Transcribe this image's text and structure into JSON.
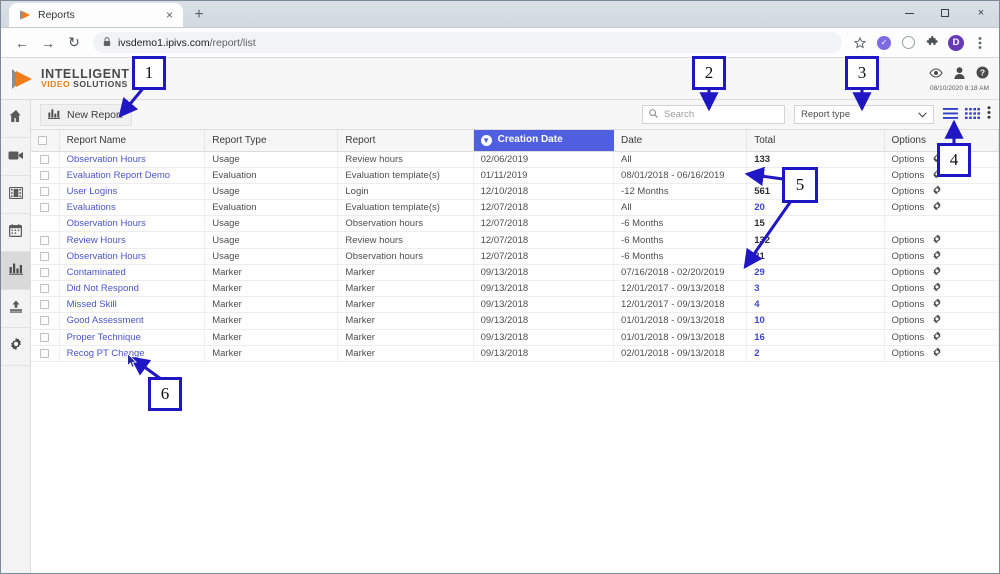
{
  "browser": {
    "tab": {
      "title": "Reports",
      "close_label": "×",
      "favicon": "ivs-play-icon"
    },
    "newtab_label": "+",
    "window_controls": {
      "minimize": "–",
      "maximize": "□",
      "close": "×"
    },
    "nav": {
      "back": "←",
      "forward": "→",
      "reload": "↻"
    },
    "omnibox": {
      "lock": "🔒",
      "host": "ivsdemo1.ipivs.com",
      "path": "/report/list"
    },
    "toolbar_icons": [
      "star-icon",
      "purple-check-badge-icon",
      "gray-circle-icon",
      "puzzle-extension-icon",
      "profile-avatar-d",
      "kebab-menu-icon"
    ],
    "profile_initial": "D"
  },
  "app_header": {
    "logo": {
      "line1": "INTELLIGENT",
      "video": "VIDEO",
      "solutions": "SOLUTIONS"
    },
    "icons": [
      "eye-icon",
      "user-icon",
      "help-icon"
    ],
    "timestamp": "08/10/2020 8:18 AM"
  },
  "sidebar": {
    "items": [
      {
        "name": "home",
        "icon": "home-icon",
        "active": false
      },
      {
        "name": "video",
        "icon": "video-camera-icon",
        "active": false
      },
      {
        "name": "media",
        "icon": "film-strip-icon",
        "active": false
      },
      {
        "name": "schedule",
        "icon": "calendar-icon",
        "active": false
      },
      {
        "name": "reports",
        "icon": "bar-chart-icon",
        "active": true
      },
      {
        "name": "upload",
        "icon": "upload-icon",
        "active": false
      },
      {
        "name": "settings",
        "icon": "gear-icon",
        "active": false
      }
    ]
  },
  "actionbar": {
    "new_report_label": "New Report",
    "new_report_icon": "bar-chart-icon",
    "search": {
      "placeholder": "Search",
      "value": "",
      "icon": "search-icon"
    },
    "report_type": {
      "value": "Report type",
      "caret": "⌄"
    },
    "view_icons": [
      "list-view-icon",
      "grid-view-icon",
      "kebab-menu-icon"
    ]
  },
  "table": {
    "columns": [
      "",
      "Report Name",
      "Report Type",
      "Report",
      "Creation Date",
      "Date",
      "Total",
      "Options"
    ],
    "sorted_column": "Creation Date",
    "sort_direction": "desc",
    "options_label": "Options",
    "rows": [
      {
        "checkbox": true,
        "name": "Observation Hours",
        "type": "Usage",
        "report": "Review hours",
        "created": "02/06/2019",
        "date": "All",
        "total": "133",
        "total_link": false,
        "options": true
      },
      {
        "checkbox": true,
        "name": "Evaluation Report Demo",
        "type": "Evaluation",
        "report": "Evaluation template(s)",
        "created": "01/11/2019",
        "date": "08/01/2018 - 06/16/2019",
        "total": "10",
        "total_link": true,
        "options": true
      },
      {
        "checkbox": true,
        "name": "User Logins",
        "type": "Usage",
        "report": "Login",
        "created": "12/10/2018",
        "date": "-12 Months",
        "total": "561",
        "total_link": false,
        "options": true
      },
      {
        "checkbox": true,
        "name": "Evaluations",
        "type": "Evaluation",
        "report": "Evaluation template(s)",
        "created": "12/07/2018",
        "date": "All",
        "total": "20",
        "total_link": true,
        "options": true
      },
      {
        "checkbox": false,
        "name": "Observation Hours",
        "type": "Usage",
        "report": "Observation hours",
        "created": "12/07/2018",
        "date": "-6 Months",
        "total": "15",
        "total_link": false,
        "options": false
      },
      {
        "checkbox": true,
        "name": "Review Hours",
        "type": "Usage",
        "report": "Review hours",
        "created": "12/07/2018",
        "date": "-6 Months",
        "total": "132",
        "total_link": false,
        "options": true
      },
      {
        "checkbox": true,
        "name": "Observation Hours",
        "type": "Usage",
        "report": "Observation hours",
        "created": "12/07/2018",
        "date": "-6 Months",
        "total": "21",
        "total_link": false,
        "options": true
      },
      {
        "checkbox": true,
        "name": "Contaminated",
        "type": "Marker",
        "report": "Marker",
        "created": "09/13/2018",
        "date": "07/16/2018 - 02/20/2019",
        "total": "29",
        "total_link": true,
        "options": true
      },
      {
        "checkbox": true,
        "name": "Did Not Respond",
        "type": "Marker",
        "report": "Marker",
        "created": "09/13/2018",
        "date": "12/01/2017 - 09/13/2018",
        "total": "3",
        "total_link": true,
        "options": true
      },
      {
        "checkbox": true,
        "name": "Missed Skill",
        "type": "Marker",
        "report": "Marker",
        "created": "09/13/2018",
        "date": "12/01/2017 - 09/13/2018",
        "total": "4",
        "total_link": true,
        "options": true
      },
      {
        "checkbox": true,
        "name": "Good Assessment",
        "type": "Marker",
        "report": "Marker",
        "created": "09/13/2018",
        "date": "01/01/2018 - 09/13/2018",
        "total": "10",
        "total_link": true,
        "options": true
      },
      {
        "checkbox": true,
        "name": "Proper Technique",
        "type": "Marker",
        "report": "Marker",
        "created": "09/13/2018",
        "date": "01/01/2018 - 09/13/2018",
        "total": "16",
        "total_link": true,
        "options": true
      },
      {
        "checkbox": true,
        "name": "Recog PT Change",
        "type": "Marker",
        "report": "Marker",
        "created": "09/13/2018",
        "date": "02/01/2018 - 09/13/2018",
        "total": "2",
        "total_link": true,
        "options": true
      }
    ]
  },
  "annotations": [
    {
      "label": "1"
    },
    {
      "label": "2"
    },
    {
      "label": "3"
    },
    {
      "label": "4"
    },
    {
      "label": "5"
    },
    {
      "label": "6"
    }
  ],
  "colors": {
    "annotation": "#1f16c4",
    "sorted_header": "#4f5fe0",
    "link": "#4a54c8",
    "brand_orange": "#e8821e"
  }
}
